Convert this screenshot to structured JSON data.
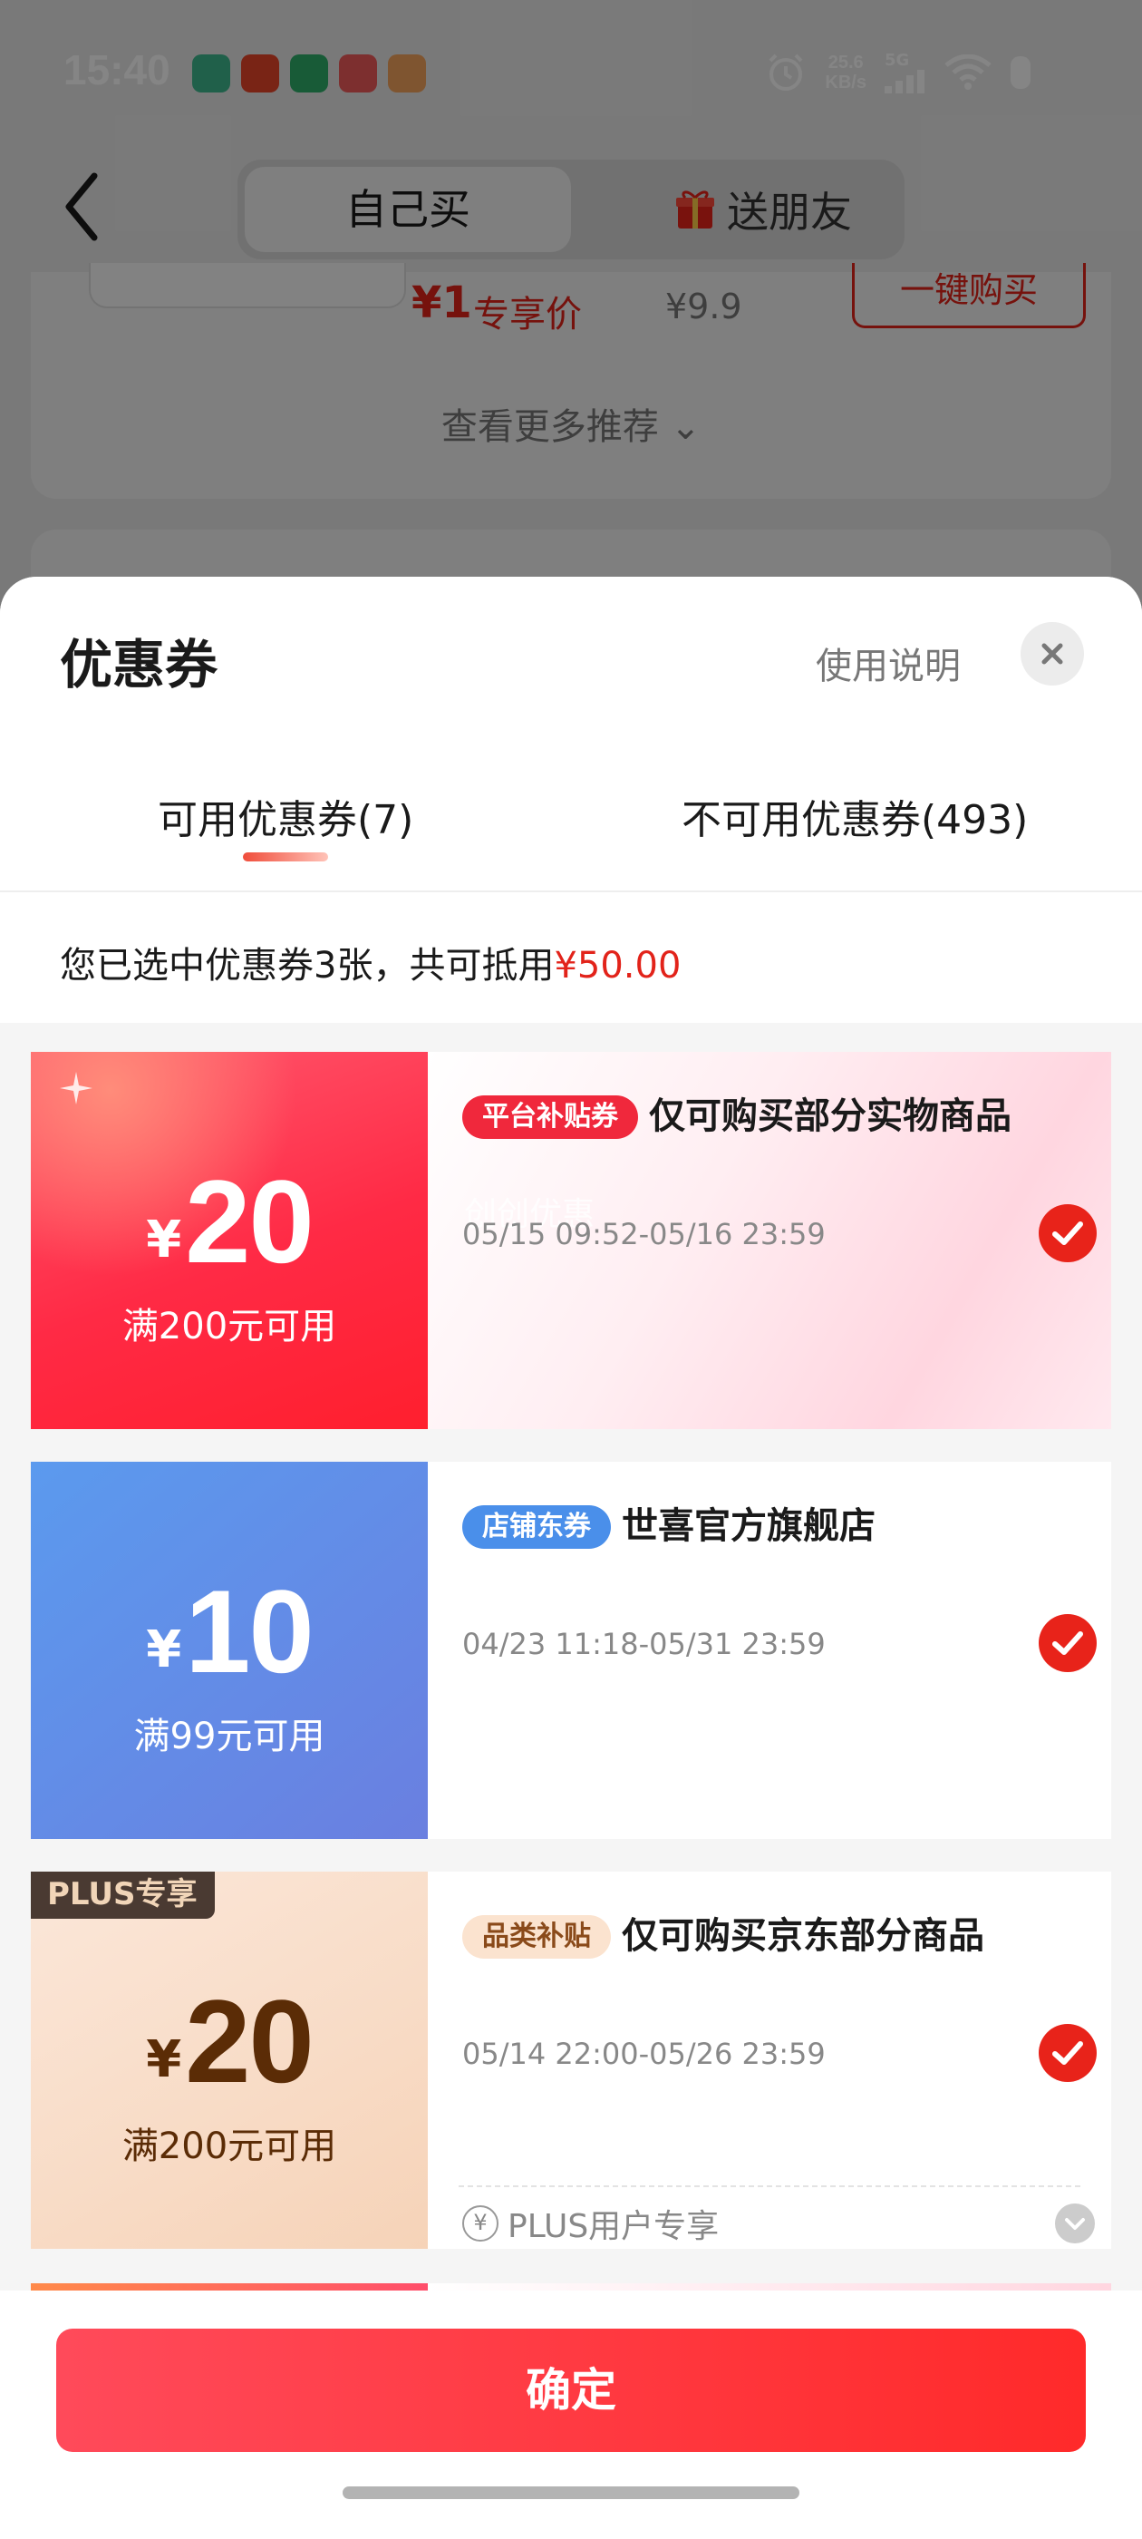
{
  "status_bar": {
    "time": "15:40",
    "net_speed_value": "25.6",
    "net_speed_unit": "KB/s",
    "signal_label": "5G",
    "icons": [
      "clock-alarm-icon",
      "signal-icon",
      "wifi-icon",
      "battery-icon"
    ]
  },
  "header": {
    "segments": [
      "自己买",
      "送朋友"
    ],
    "selected_segment": "自己买"
  },
  "product": {
    "price": "¥1",
    "price_label": "专享价",
    "original_price": "¥9.9",
    "buy_button": "一键购买",
    "more_recommendations": "查看更多推荐 ⌄"
  },
  "coupon_sheet": {
    "title": "优惠券",
    "usage_link": "使用说明",
    "tabs": [
      {
        "label": "可用优惠券(7)",
        "active": true
      },
      {
        "label": "不可用优惠券(493)",
        "active": false
      }
    ],
    "summary_prefix": "您已选中优惠券3张，共可抵用",
    "summary_amount": "¥50.00",
    "coupons": [
      {
        "yen": "¥",
        "amount": "20",
        "condition": "满200元可用",
        "tag": "平台补贴券",
        "tag_color": "#f0283c",
        "title": "仅可购买部分实物商品",
        "validity": "05/15 09:52-05/16 23:59",
        "watermark": "创创优惠",
        "selected": true
      },
      {
        "yen": "¥",
        "amount": "10",
        "condition": "满99元可用",
        "tag": "店铺东券",
        "tag_color": "#4a8fea",
        "title": "世喜官方旗舰店",
        "validity": "04/23 11:18-05/31 23:59",
        "selected": true
      },
      {
        "badge": "PLUS专享",
        "yen": "¥",
        "amount": "20",
        "condition": "满200元可用",
        "tag": "品类补贴",
        "tag_color": "#fbe3cf",
        "title": "仅可购买京东部分商品",
        "validity": "05/14 22:00-05/26 23:59",
        "selected": true,
        "plus_note": "PLUS用户专享"
      }
    ],
    "confirm_button": "确定"
  },
  "colors": {
    "accent": "#e2231a",
    "confirm_gradient_start": "#ff4a5a",
    "confirm_gradient_end": "#ff2a2a"
  }
}
